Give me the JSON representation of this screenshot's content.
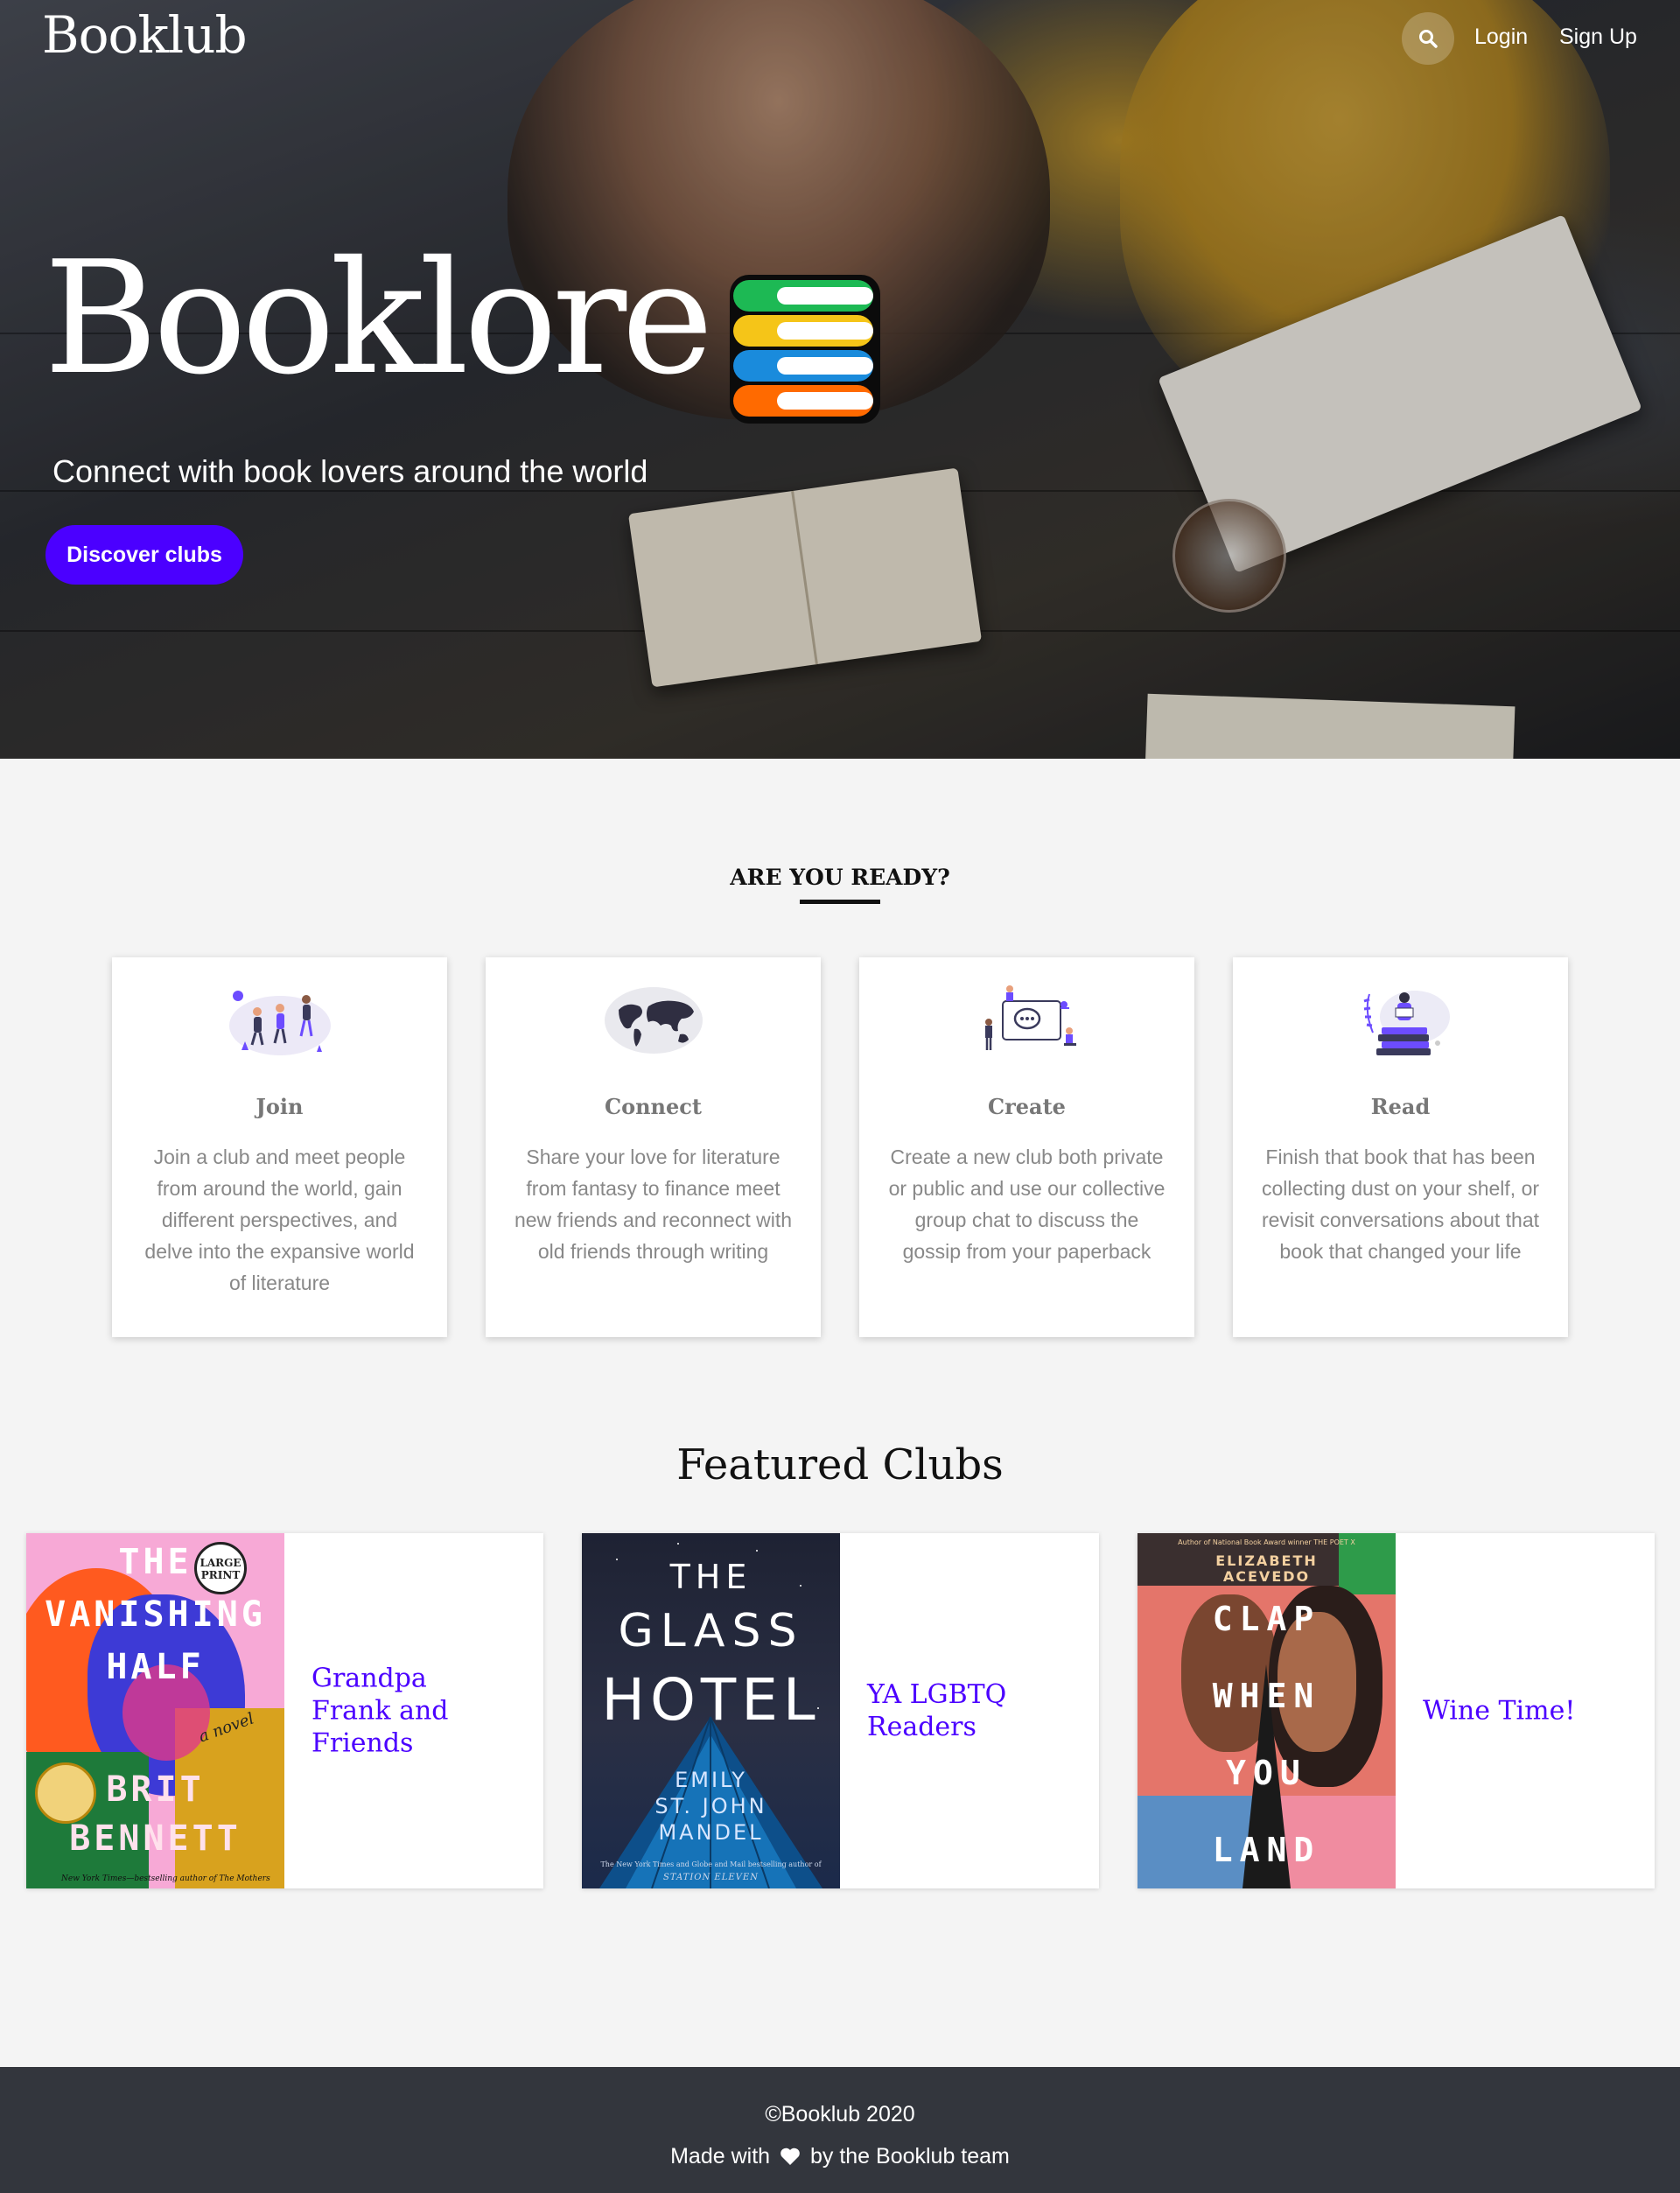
{
  "header": {
    "logo": "Booklub",
    "nav": {
      "login": "Login",
      "signup": "Sign Up"
    },
    "search_icon": "search-icon"
  },
  "hero": {
    "title": "Booklore",
    "subtitle": "Connect with book lovers around the world",
    "cta": "Discover clubs",
    "icon": "book-stack-icon",
    "stack_colors": [
      "#1db954",
      "#f5c518",
      "#1a8bdc",
      "#ff6a00"
    ]
  },
  "ready": {
    "title": "ARE YOU READY?",
    "cards": [
      {
        "title": "Join",
        "text": "Join a club and meet people from around the world, gain different perspectives, and delve into the expansive world of literature",
        "icon": "people-jumping-illustration"
      },
      {
        "title": "Connect",
        "text": "Share your love for literature from fantasy to finance meet new friends and reconnect with old friends through writing",
        "icon": "world-map-illustration"
      },
      {
        "title": "Create",
        "text": "Create a new club both private or public and use our collective group chat to discuss the gossip from your paperback",
        "icon": "group-chat-illustration"
      },
      {
        "title": "Read",
        "text": "Finish that book that has been collecting dust on your shelf, or revisit conversations about that book that changed your life",
        "icon": "reader-on-books-illustration"
      }
    ]
  },
  "featured": {
    "title": "Featured Clubs",
    "clubs": [
      {
        "name": "Grandpa Frank and Friends",
        "cover": {
          "lines": [
            "THE",
            "VANISHING",
            "HALF"
          ],
          "author": [
            "BRIT",
            "BENNETT"
          ],
          "badge": [
            "LARGE",
            "PRINT"
          ],
          "script": "a novel",
          "tagline": "New York Times—bestselling author of The Mothers"
        }
      },
      {
        "name": "YA LGBTQ Readers",
        "cover": {
          "lines": [
            "THE",
            "GLASS",
            "HOTEL"
          ],
          "author": [
            "EMILY",
            "ST. JOHN",
            "MANDEL"
          ],
          "tagline": "The New York Times and Globe and Mail bestselling author of",
          "subtag": "STATION ELEVEN"
        }
      },
      {
        "name": "Wine Time!",
        "cover": {
          "top": "Author of National Book Award winner THE POET X",
          "author": [
            "ELIZABETH",
            "ACEVEDO"
          ],
          "lines": [
            "CLAP",
            "WHEN",
            "YOU",
            "LAND"
          ]
        }
      }
    ]
  },
  "footer": {
    "copyright": "©Booklub 2020",
    "made_pre": "Made with",
    "made_post": "by the Booklub team",
    "heart_icon": "heart-icon"
  },
  "colors": {
    "accent": "#4b00ff",
    "footer_bg": "#33363d",
    "page_bg": "#f4f4f4"
  }
}
